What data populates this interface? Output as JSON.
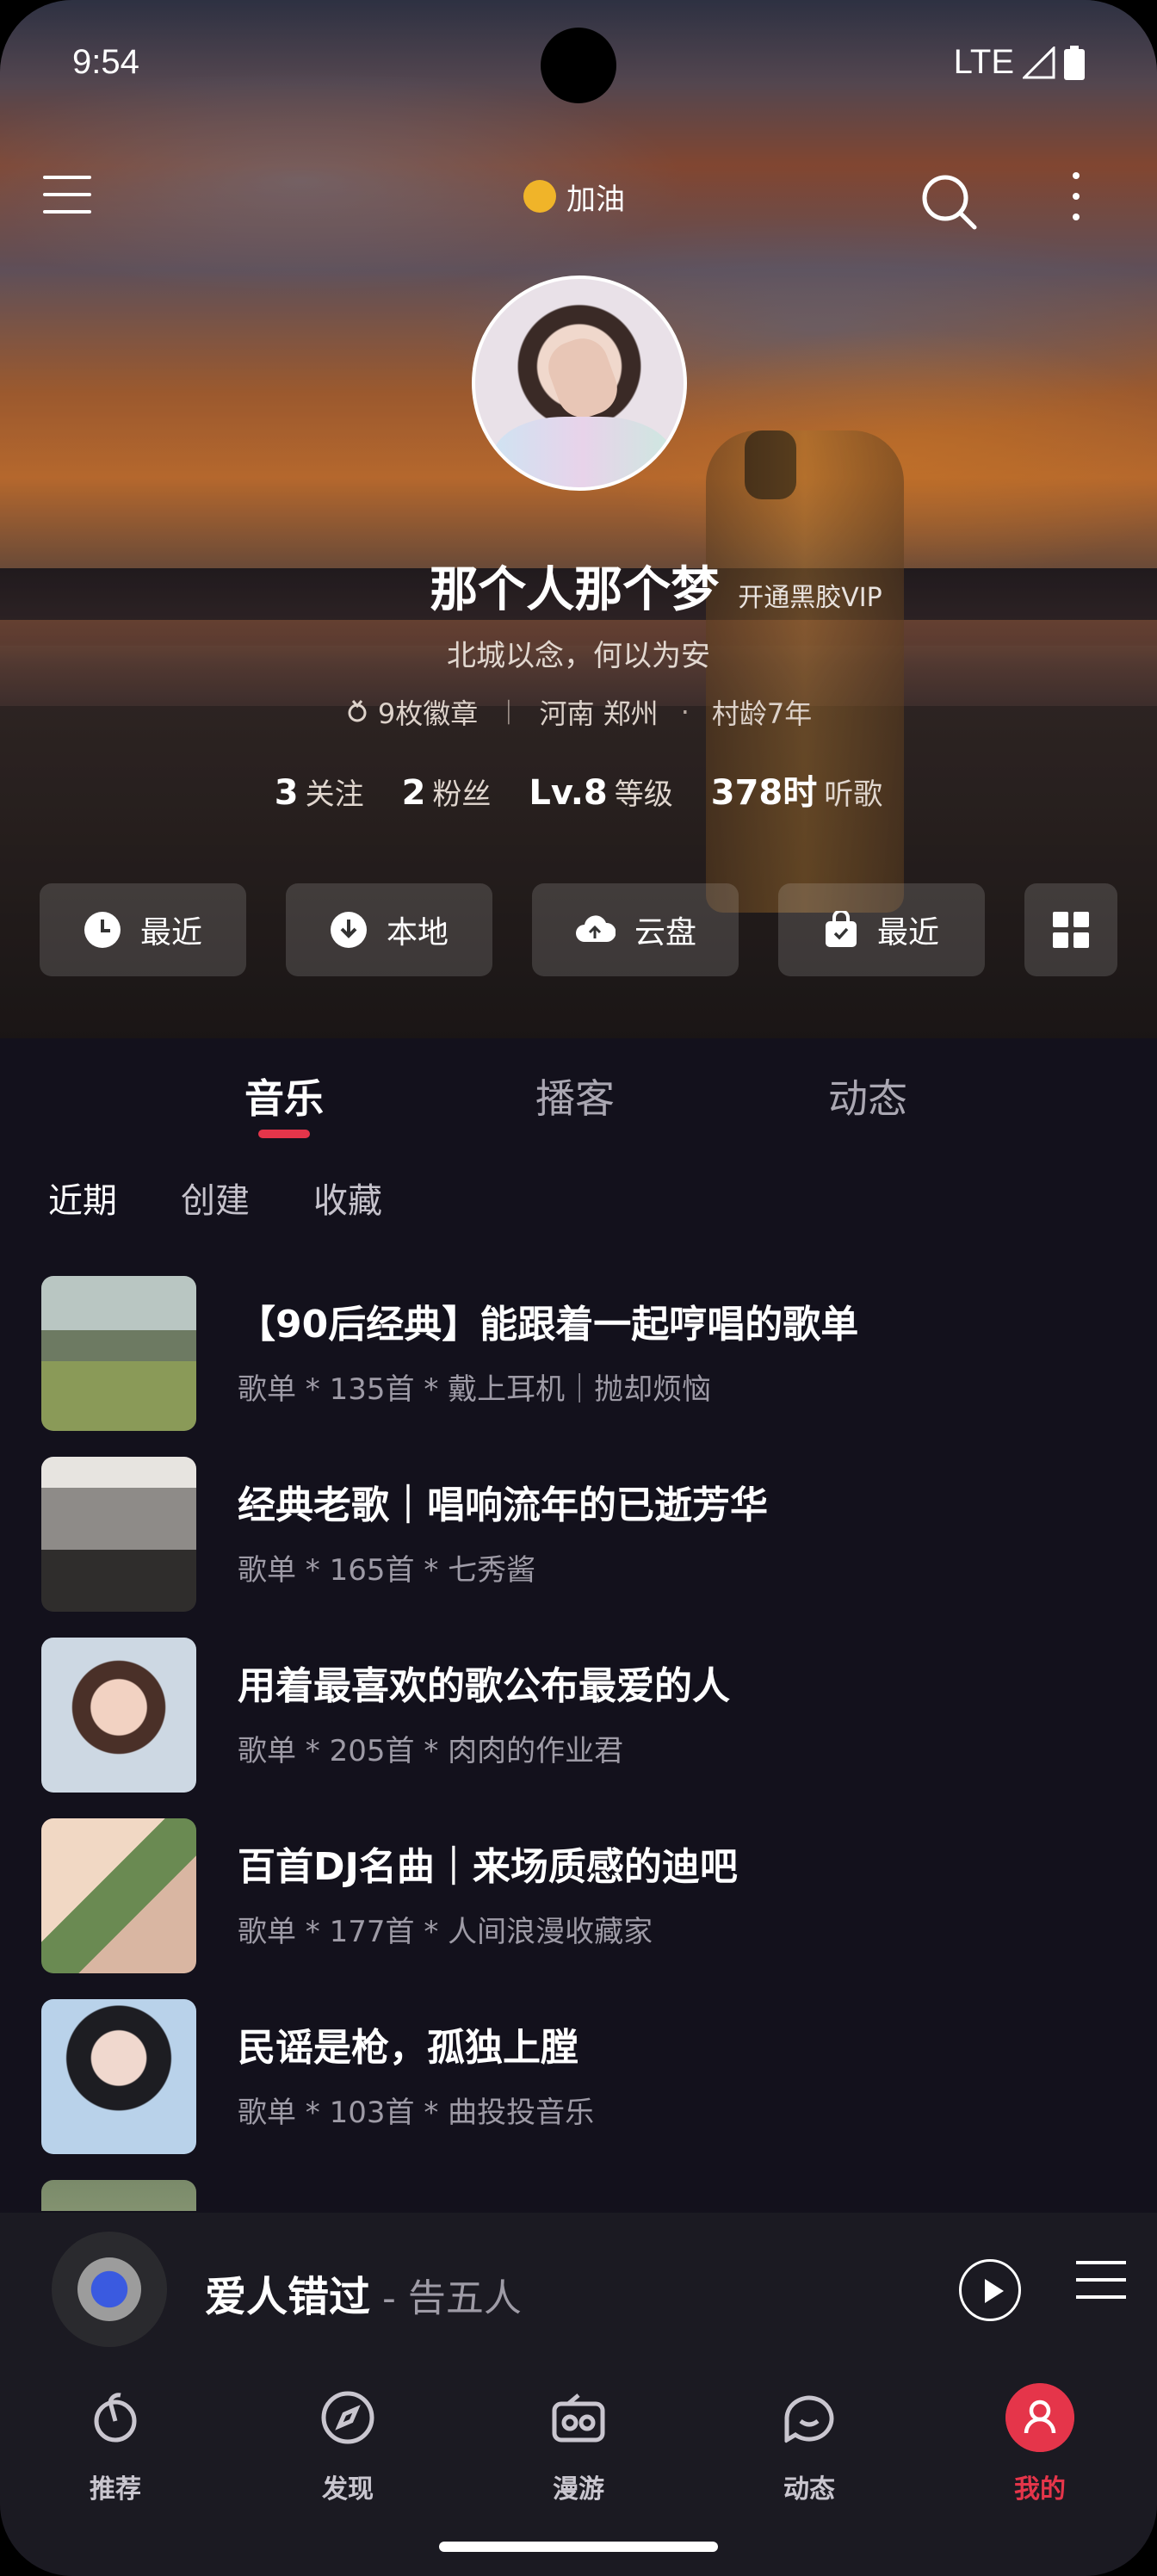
{
  "status_bar": {
    "time": "9:54",
    "network": "LTE"
  },
  "topbar": {
    "vip_label": "加油"
  },
  "profile": {
    "name": "那个人那个梦",
    "vip_link": "开通黑胶VIP",
    "signature": "北城以念，何以为安",
    "badges": "9枚徽章",
    "location": "河南 郑州",
    "village_age": "村龄7年",
    "stats": [
      {
        "num": "3",
        "label": "关注"
      },
      {
        "num": "2",
        "label": "粉丝"
      },
      {
        "num": "Lv.8",
        "label": "等级"
      },
      {
        "num": "378时",
        "label": "听歌"
      }
    ]
  },
  "quick_buttons": [
    {
      "label": "最近",
      "icon": "clock-icon"
    },
    {
      "label": "本地",
      "icon": "download-icon"
    },
    {
      "label": "云盘",
      "icon": "cloud-upload-icon"
    },
    {
      "label": "最近",
      "icon": "shopping-bag-icon"
    }
  ],
  "tabs": [
    "音乐",
    "播客",
    "动态"
  ],
  "subtabs": [
    "近期",
    "创建",
    "收藏"
  ],
  "playlists": [
    {
      "title": "【90后经典】能跟着一起哼唱的歌单",
      "sub": "歌单 * 135首 * 戴上耳机｜抛却烦恼"
    },
    {
      "title": "经典老歌｜唱响流年的已逝芳华",
      "sub": "歌单 * 165首 * 七秀酱"
    },
    {
      "title": "用着最喜欢的歌公布最爱的人",
      "sub": "歌单 * 205首 * 肉肉的作业君"
    },
    {
      "title": "百首DJ名曲｜来场质感的迪吧",
      "sub": "歌单 * 177首 * 人间浪漫收藏家"
    },
    {
      "title": "民谣是枪，孤独上膛",
      "sub": "歌单 * 103首 * 曲投投音乐"
    }
  ],
  "player": {
    "song": "爱人错过",
    "artist": " - 告五人"
  },
  "nav": [
    {
      "label": "推荐",
      "icon": "netease-music-icon"
    },
    {
      "label": "发现",
      "icon": "compass-icon"
    },
    {
      "label": "漫游",
      "icon": "radio-icon"
    },
    {
      "label": "动态",
      "icon": "chat-bubble-icon"
    },
    {
      "label": "我的",
      "icon": "user-icon"
    }
  ],
  "colors": {
    "accent": "#e5354a",
    "background": "#13111c"
  }
}
